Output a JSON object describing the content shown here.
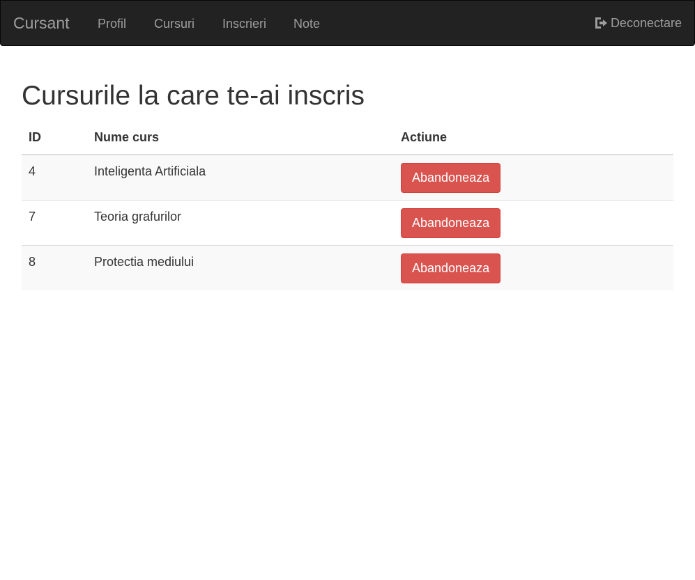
{
  "navbar": {
    "brand": "Cursant",
    "items": [
      {
        "label": "Profil"
      },
      {
        "label": "Cursuri"
      },
      {
        "label": "Inscrieri"
      },
      {
        "label": "Note"
      }
    ],
    "logout_label": "Deconectare",
    "logout_icon": "log-out-icon",
    "background": "#222222",
    "text_color": "#9d9d9d"
  },
  "main": {
    "title": "Cursurile la care te-ai inscris",
    "table": {
      "headers": [
        "ID",
        "Nume curs",
        "Actiune"
      ],
      "rows": [
        {
          "id": "4",
          "name": "Inteligenta Artificiala",
          "action": "Abandoneaza"
        },
        {
          "id": "7",
          "name": "Teoria grafurilor",
          "action": "Abandoneaza"
        },
        {
          "id": "8",
          "name": "Protectia mediului",
          "action": "Abandoneaza"
        }
      ]
    },
    "danger_color": "#d9534f"
  }
}
